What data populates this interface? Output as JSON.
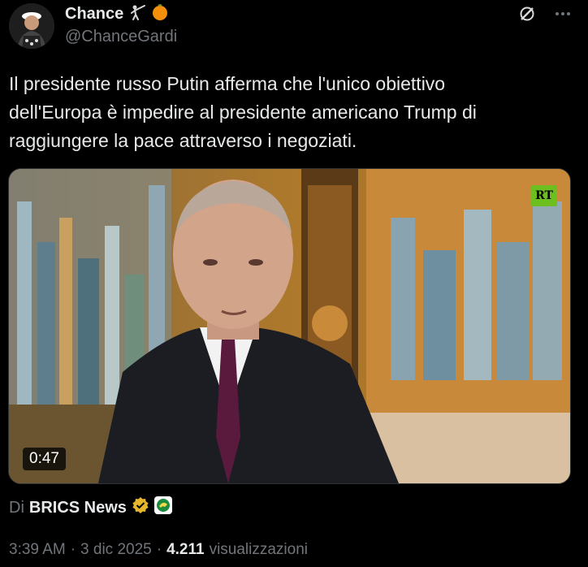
{
  "author": {
    "display_name": "Chance",
    "handle": "@ChanceGardi"
  },
  "icons": {
    "fencer": "fencer-icon",
    "orange_dot": "orange-circle-icon",
    "grok": "grok-icon",
    "more": "more-icon",
    "verified": "verified-badge-icon",
    "source_badge": "affiliate-badge-icon"
  },
  "tweet": {
    "text": "Il presidente russo Putin afferma che l'unico obiettivo\ndell'Europa è impedire al presidente americano Trump di\nraggiungere la pace attraverso i negoziati."
  },
  "media": {
    "duration": "0:47",
    "watermark": "RT"
  },
  "attribution": {
    "prefix": "Di",
    "source": "BRICS News"
  },
  "meta": {
    "time": "3:39 AM",
    "separator1": "·",
    "date": "3 dic 2025",
    "separator2": "·",
    "views": "4.211",
    "views_label": "visualizzazioni"
  },
  "colors": {
    "background": "#000000",
    "text": "#e7e9ea",
    "secondary": "#71767b",
    "verified": "#e8b62a",
    "rt_green": "#6cbf1f"
  }
}
